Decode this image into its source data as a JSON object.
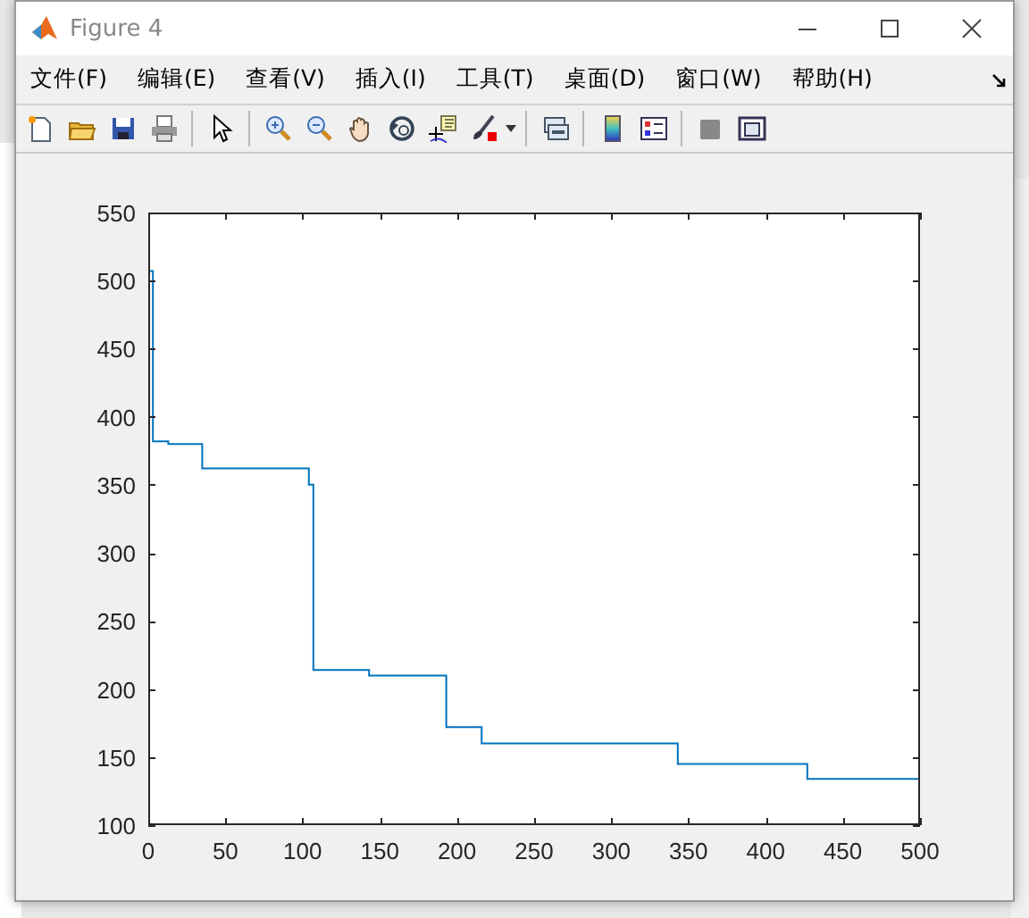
{
  "window": {
    "title": "Figure 4"
  },
  "menu": [
    "文件(F)",
    "编辑(E)",
    "查看(V)",
    "插入(I)",
    "工具(T)",
    "桌面(D)",
    "窗口(W)",
    "帮助(H)"
  ],
  "axes": {
    "chart_data": {
      "type": "line",
      "xlim": [
        0,
        500
      ],
      "ylim": [
        100,
        550
      ],
      "xticks": [
        0,
        50,
        100,
        150,
        200,
        250,
        300,
        350,
        400,
        450,
        500
      ],
      "yticks": [
        100,
        150,
        200,
        250,
        300,
        350,
        400,
        450,
        500,
        550
      ],
      "x": [
        0,
        3,
        3,
        13,
        13,
        35,
        35,
        104,
        104,
        107,
        107,
        143,
        143,
        193,
        193,
        216,
        216,
        343,
        343,
        427,
        427,
        500
      ],
      "series": [
        {
          "color": "#0072bd",
          "values": [
            507,
            507,
            382,
            382,
            380,
            380,
            362,
            362,
            350,
            350,
            214,
            214,
            210,
            210,
            172,
            172,
            160,
            160,
            145,
            145,
            134,
            134
          ]
        }
      ]
    }
  }
}
